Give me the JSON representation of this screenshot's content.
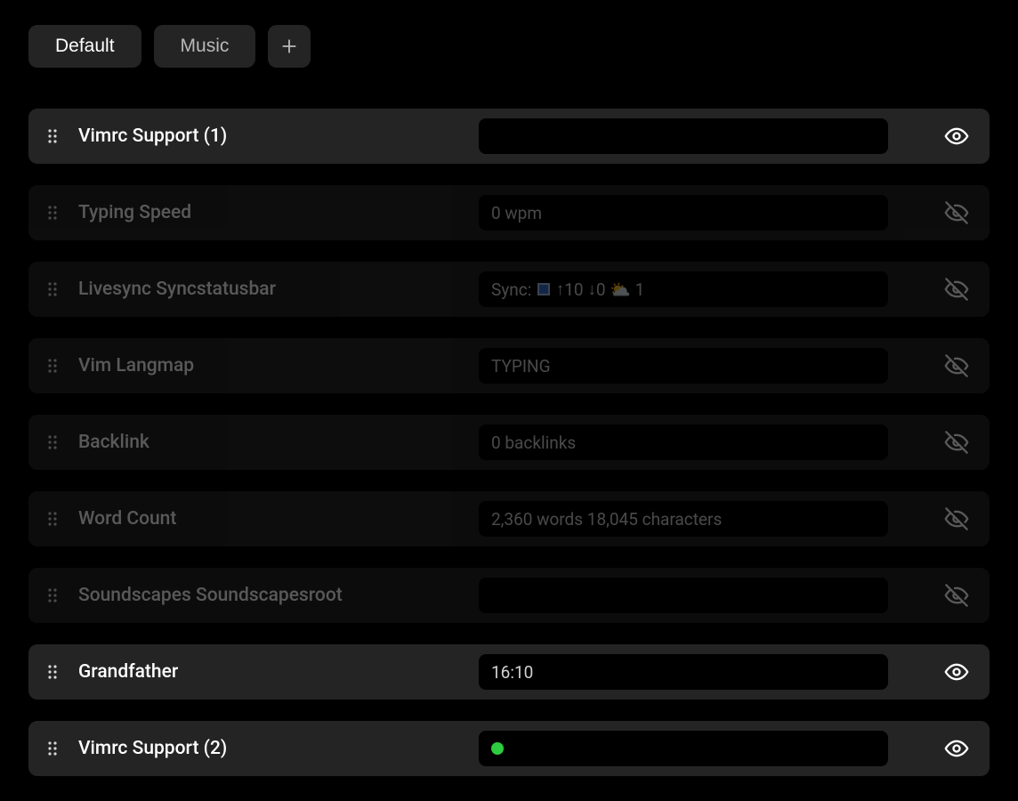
{
  "tabs": [
    {
      "label": "Default",
      "active": true
    },
    {
      "label": "Music",
      "active": false
    }
  ],
  "items": [
    {
      "label": "Vimrc Support (1)",
      "value": "",
      "visible": true,
      "value_type": "text"
    },
    {
      "label": "Typing Speed",
      "value": "0 wpm",
      "visible": false,
      "value_type": "text"
    },
    {
      "label": "Livesync Syncstatusbar",
      "value": "Sync: 🔲 ↑10 ↓0 ⛅ 1",
      "visible": false,
      "value_type": "sync"
    },
    {
      "label": "Vim Langmap",
      "value": "TYPING",
      "visible": false,
      "value_type": "text"
    },
    {
      "label": "Backlink",
      "value": "0 backlinks",
      "visible": false,
      "value_type": "text"
    },
    {
      "label": "Word Count",
      "value": "2,360 words  18,045 characters",
      "visible": false,
      "value_type": "text"
    },
    {
      "label": "Soundscapes Soundscapesroot",
      "value": "",
      "visible": false,
      "value_type": "text"
    },
    {
      "label": "Grandfather",
      "value": "16:10",
      "visible": true,
      "value_type": "text"
    },
    {
      "label": "Vimrc Support (2)",
      "value": "",
      "visible": true,
      "value_type": "dot"
    }
  ],
  "sync_detail": {
    "prefix": "Sync:",
    "up_count": "10",
    "down_count": "0",
    "extra_count": "1"
  }
}
